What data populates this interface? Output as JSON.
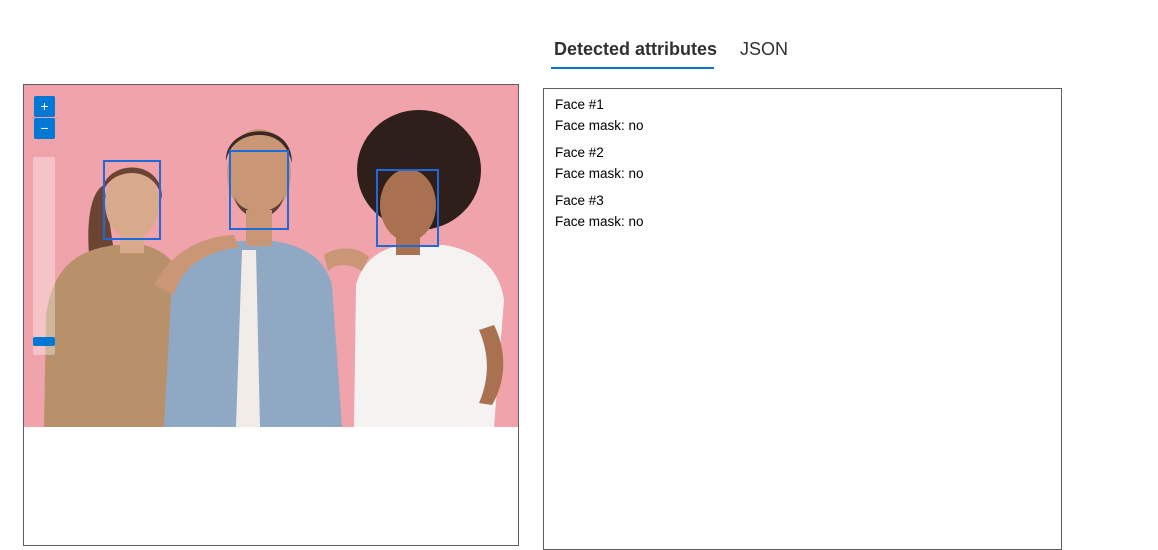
{
  "tabs": [
    {
      "label": "Detected attributes",
      "active": true
    },
    {
      "label": "JSON",
      "active": false
    }
  ],
  "viewer": {
    "zoom_in_label": "+",
    "zoom_out_label": "−",
    "zoom_level": 0.05
  },
  "faces": [
    {
      "title": "Face #1",
      "mask_label": "Face mask: no"
    },
    {
      "title": "Face #2",
      "mask_label": "Face mask: no"
    },
    {
      "title": "Face #3",
      "mask_label": "Face mask: no"
    }
  ],
  "colors": {
    "accent": "#0078d4",
    "face_box": "#1f6ad8",
    "photo_background": "#f0a3ab"
  }
}
